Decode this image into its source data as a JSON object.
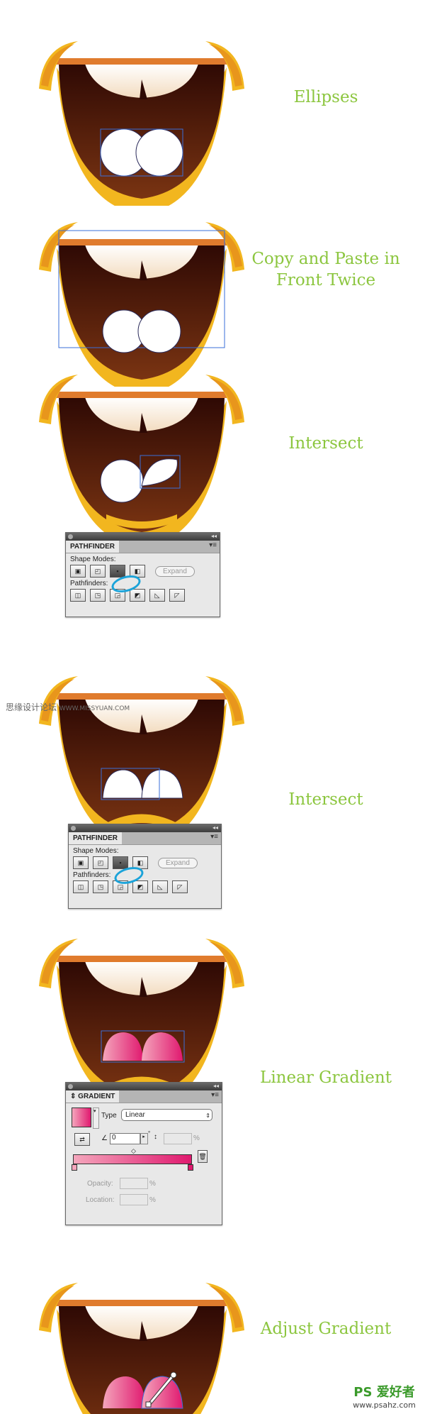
{
  "steps": [
    {
      "label": "Ellipses"
    },
    {
      "label": "Copy and Paste in Front Twice"
    },
    {
      "label": "Intersect"
    },
    {
      "label": "Intersect"
    },
    {
      "label": "Linear Gradient"
    },
    {
      "label": "Adjust Gradient"
    }
  ],
  "pathfinder_panel": {
    "title": "PATHFINDER",
    "shape_modes_label": "Shape Modes:",
    "pathfinders_label": "Pathfinders:",
    "expand_label": "Expand",
    "active_mode": "intersect"
  },
  "gradient_panel": {
    "title": "GRADIENT",
    "type_label": "Type",
    "type_value": "Linear",
    "angle_value": "0",
    "angle_unit": "°",
    "aspect_unit": "%",
    "opacity_label": "Opacity:",
    "location_label": "Location:",
    "percent": "%",
    "start_color": "#f4a6bc",
    "end_color": "#e0196f"
  },
  "watermarks": {
    "site_cn": "思缘设计论坛",
    "site_url": "WWW.MISSYUAN.COM",
    "logo_text": "PS 爱好者",
    "logo_url": "www.psahz.com"
  },
  "colors": {
    "label_green": "#8cc63f",
    "selection_blue": "#3a6fd8",
    "highlight_ring": "#1ba3d9"
  }
}
